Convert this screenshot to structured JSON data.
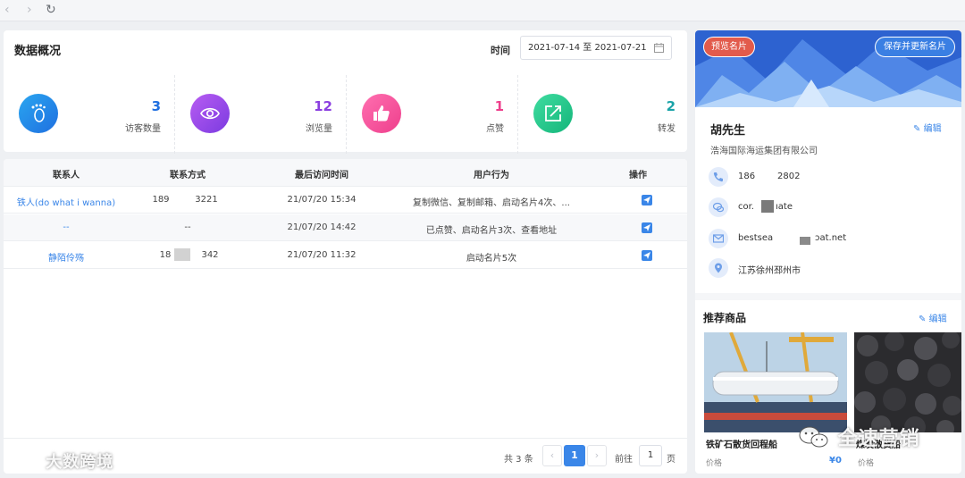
{
  "browser": {
    "back": "‹",
    "forward": "›",
    "reload": "↻"
  },
  "overview": {
    "title": "数据概况",
    "time_label": "时间",
    "date_range": "2021-07-14 至 2021-07-21",
    "stats": [
      {
        "value": "3",
        "label": "访客数量",
        "icon": "footprint-icon",
        "color": "#1f6fe0"
      },
      {
        "value": "12",
        "label": "浏览量",
        "icon": "eye-icon",
        "color": "#8b3fe0"
      },
      {
        "value": "1",
        "label": "点赞",
        "icon": "thumbs-up-icon",
        "color": "#ee3f8c"
      },
      {
        "value": "2",
        "label": "转发",
        "icon": "share-icon",
        "color": "#1aa3a8"
      }
    ]
  },
  "table": {
    "headers": [
      "联系人",
      "联系方式",
      "最后访问时间",
      "用户行为",
      "操作"
    ],
    "rows": [
      {
        "contact": "铁人(do what i wanna)",
        "phone_a": "189",
        "phone_b": "3221",
        "time": "21/07/20 15:34",
        "behavior": "复制微信、复制邮箱、启动名片4次、..."
      },
      {
        "contact": "--",
        "phone_a": "--",
        "phone_b": "",
        "time": "21/07/20 14:42",
        "behavior": "已点赞、启动名片3次、查看地址"
      },
      {
        "contact": "静陌伶殇",
        "phone_a": "18",
        "phone_b": "342",
        "time": "21/07/20 11:32",
        "behavior": "启动名片5次"
      }
    ]
  },
  "pagination": {
    "total": "共 3 条",
    "current": "1",
    "goto": "前往",
    "page_input": "1",
    "page_unit": "页",
    "prev": "‹",
    "next": "›"
  },
  "card": {
    "preview": "预览名片",
    "save": "保存并更新名片",
    "name": "胡先生",
    "edit": "编辑",
    "company": "浩海国际海运集团有限公司",
    "phone_a": "186",
    "phone_b": "2802",
    "wechat_a": "cor.",
    "wechat_b": "ıate",
    "email_a": "bestsea",
    "email_b": "ɔat.net",
    "address": "江苏徐州邳州市"
  },
  "products": {
    "title": "推荐商品",
    "edit": "编辑",
    "items": [
      {
        "name": "铁矿石散货回程船",
        "price_label": "价格",
        "price": "¥0"
      },
      {
        "name": "煤炭散货船",
        "price_label": "价格",
        "price": ""
      }
    ]
  },
  "watermarks": {
    "left": "大数跨境",
    "right": "全速营销"
  }
}
